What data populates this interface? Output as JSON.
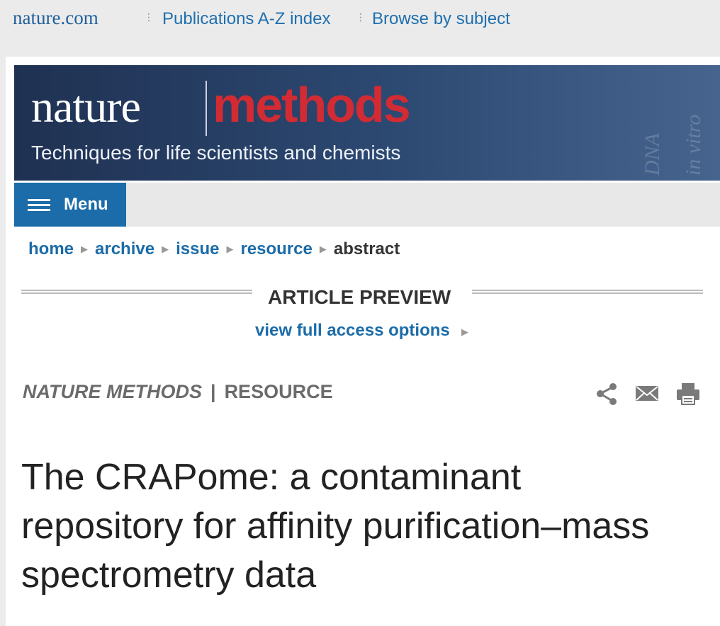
{
  "topnav": {
    "brand": "nature.com",
    "links": [
      "Publications A-Z index",
      "Browse by subject"
    ]
  },
  "banner": {
    "logo_nature": "nature",
    "logo_methods": "methods",
    "tagline": "Techniques for life scientists and chemists",
    "watermark": [
      "DNA",
      "in vitro"
    ]
  },
  "menu": {
    "label": "Menu"
  },
  "breadcrumb": {
    "links": [
      "home",
      "archive",
      "issue",
      "resource"
    ],
    "current": "abstract"
  },
  "preview": {
    "title": "ARTICLE PREVIEW",
    "access_link": "view full access options"
  },
  "article": {
    "journal": "NATURE METHODS",
    "type": "RESOURCE",
    "title_lines": [
      "The CRAPome: a contaminant",
      "repository for affinity purification–mass",
      "spectrometry data"
    ]
  },
  "tools": [
    "share-icon",
    "email-icon",
    "print-icon"
  ],
  "colors": {
    "link_blue": "#1b6ca8",
    "brand_red": "#d22b34",
    "banner_navy": "#1f3152"
  }
}
